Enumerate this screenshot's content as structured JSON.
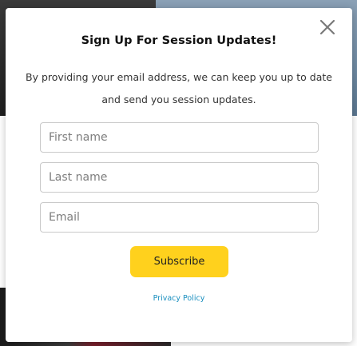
{
  "modal": {
    "title": "Sign Up For Session Updates!",
    "description": "By providing your email address, we can keep you up to date and send you session updates.",
    "close_icon": "close-icon",
    "fields": {
      "first_name_placeholder": "First name",
      "last_name_placeholder": "Last name",
      "email_placeholder": "Email"
    },
    "subscribe_label": "Subscribe",
    "privacy_label": "Privacy Policy"
  },
  "colors": {
    "subscribe_bg": "#ffd11d",
    "link": "#1a8fbf",
    "title": "#111111"
  }
}
